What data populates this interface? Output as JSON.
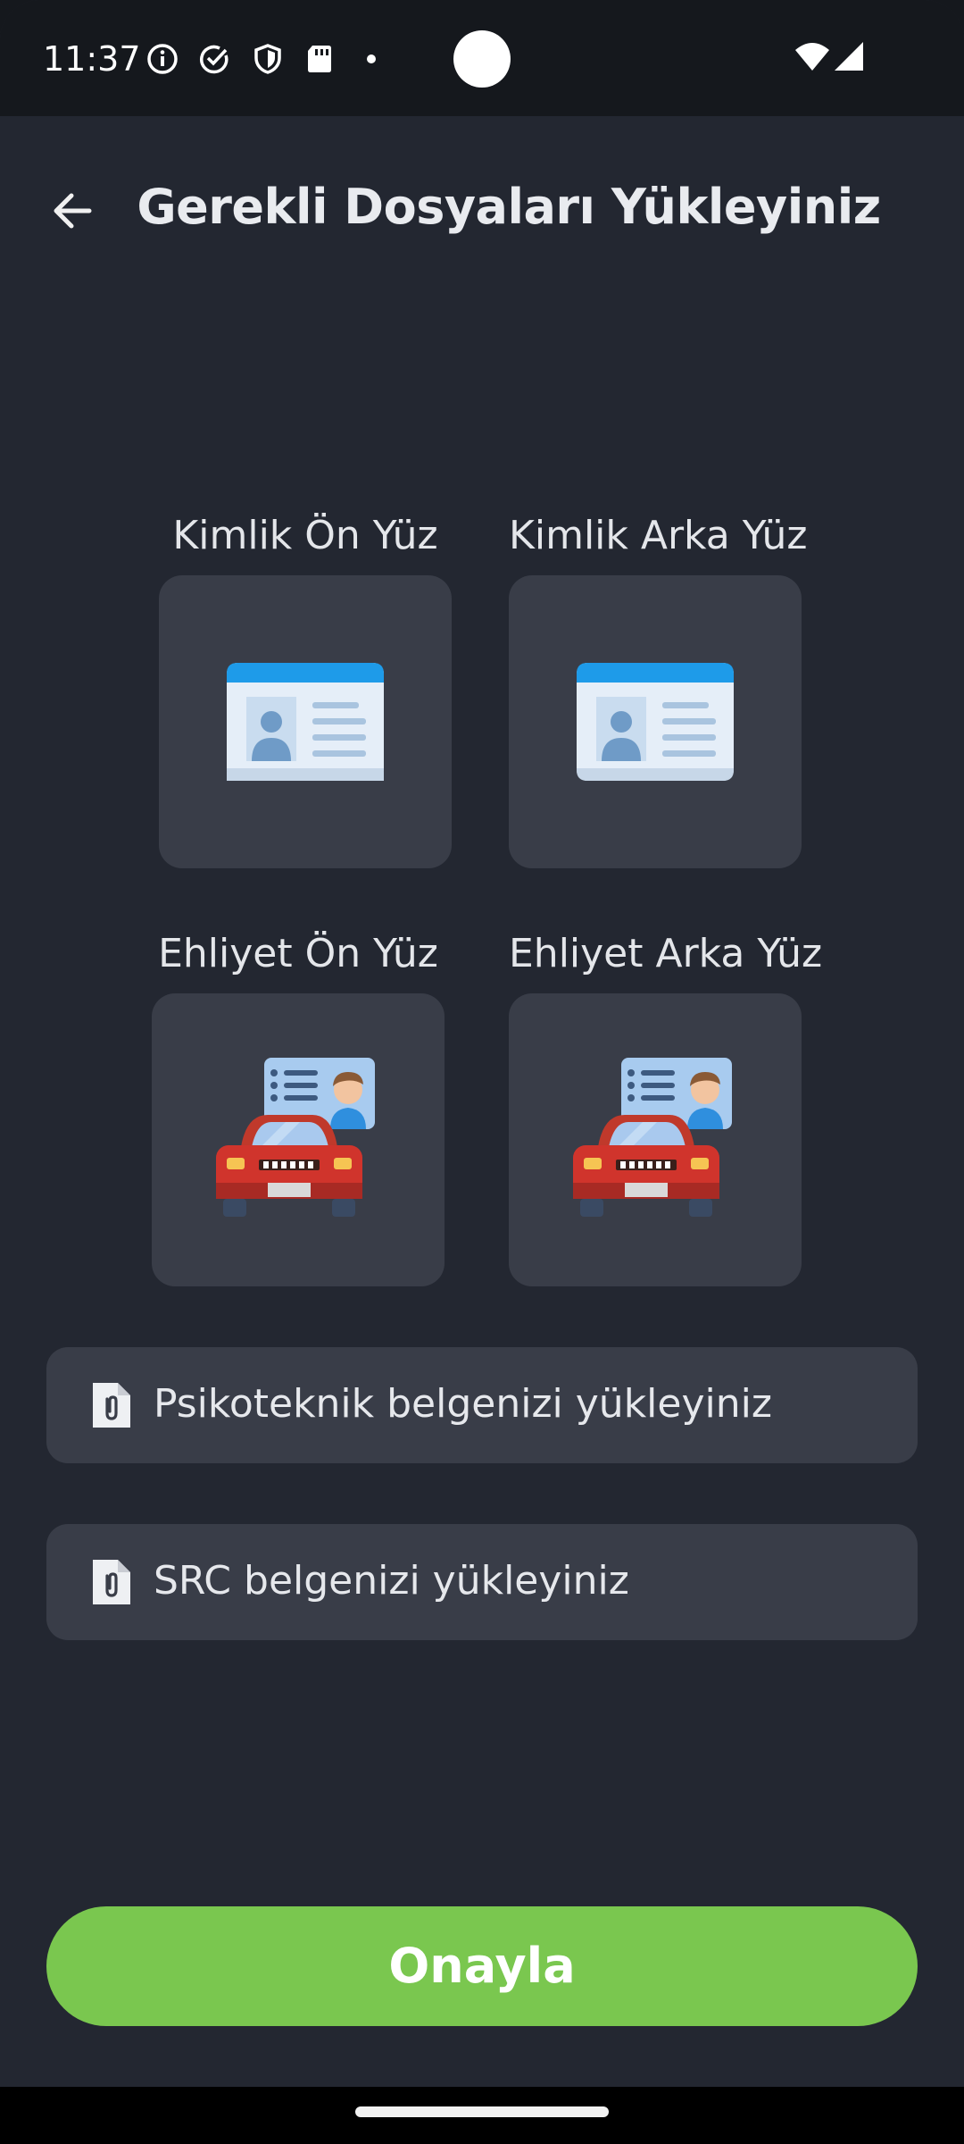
{
  "status_bar": {
    "time": "11:37",
    "icons": [
      "info-icon",
      "check-circle-icon",
      "shield-icon",
      "sd-card-icon",
      "dot-icon",
      "wifi-icon",
      "signal-icon"
    ]
  },
  "header": {
    "back_icon": "arrow-left-icon",
    "title": "Gerekli Dosyaları Yükleyiniz"
  },
  "documents": [
    {
      "label": "Kimlik Ön Yüz",
      "icon": "id-card-icon"
    },
    {
      "label": "Kimlik Arka Yüz",
      "icon": "id-card-icon"
    },
    {
      "label": "Ehliyet Ön Yüz",
      "icon": "driver-license-icon"
    },
    {
      "label": "Ehliyet Arka Yüz",
      "icon": "driver-license-icon"
    }
  ],
  "uploads": [
    {
      "label": "Psikoteknik belgenizi yükleyiniz",
      "icon": "file-attachment-icon"
    },
    {
      "label": "SRC belgenizi yükleyiniz",
      "icon": "file-attachment-icon"
    }
  ],
  "actions": {
    "confirm_label": "Onayla"
  },
  "colors": {
    "background": "#232731",
    "card": "#393d48",
    "accent_green": "#7ac74f",
    "text": "#e9ebef"
  }
}
